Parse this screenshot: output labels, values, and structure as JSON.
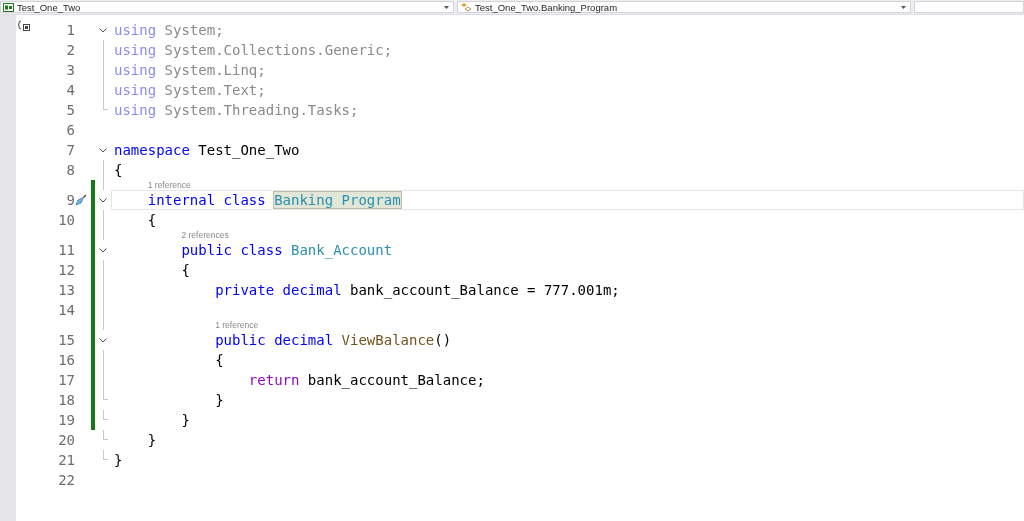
{
  "navigation_bar": {
    "project": "Test_One_Two",
    "type": "Test_One_Two.Banking_Program"
  },
  "editor": {
    "lines": [
      {
        "number": "1",
        "kind": "fold_start",
        "changed": false,
        "current": false,
        "quick_action": false,
        "tokens": [
          {
            "kind": "faded_keyword",
            "text": "using"
          },
          {
            "kind": "faded",
            "text": " System;"
          }
        ]
      },
      {
        "number": "2",
        "kind": "fold_inner",
        "changed": false,
        "current": false,
        "quick_action": false,
        "tokens": [
          {
            "kind": "faded_keyword",
            "text": "using"
          },
          {
            "kind": "faded",
            "text": " System.Collections.Generic;"
          }
        ]
      },
      {
        "number": "3",
        "kind": "fold_inner",
        "changed": false,
        "current": false,
        "quick_action": false,
        "tokens": [
          {
            "kind": "faded_keyword",
            "text": "using"
          },
          {
            "kind": "faded",
            "text": " System.Linq;"
          }
        ]
      },
      {
        "number": "4",
        "kind": "fold_inner",
        "changed": false,
        "current": false,
        "quick_action": false,
        "tokens": [
          {
            "kind": "faded_keyword",
            "text": "using"
          },
          {
            "kind": "faded",
            "text": " System.Text;"
          }
        ]
      },
      {
        "number": "5",
        "kind": "fold_end",
        "changed": false,
        "current": false,
        "quick_action": false,
        "tokens": [
          {
            "kind": "faded_keyword",
            "text": "using"
          },
          {
            "kind": "faded",
            "text": " System.Threading.Tasks;"
          }
        ]
      },
      {
        "number": "6",
        "kind": "plain",
        "changed": false,
        "current": false,
        "quick_action": false
      },
      {
        "number": "7",
        "kind": "fold_start",
        "changed": false,
        "current": false,
        "quick_action": false,
        "tokens": [
          {
            "kind": "keyword",
            "text": "namespace"
          },
          {
            "kind": "plain",
            "text": " Test_One_Two"
          }
        ]
      },
      {
        "number": "8",
        "kind": "fold_inner",
        "changed": false,
        "current": false,
        "quick_action": false,
        "tokens": [
          {
            "kind": "plain",
            "text": "{"
          }
        ]
      },
      {
        "number": "9",
        "kind": "fold_start",
        "changed": true,
        "current": true,
        "quick_action": true,
        "codelens": "1 reference",
        "tokens": [
          {
            "kind": "keyword",
            "text": "    internal class "
          },
          {
            "kind": "type",
            "text": "Banking_Program",
            "highlighted": true
          }
        ]
      },
      {
        "number": "10",
        "kind": "fold_inner",
        "changed": true,
        "current": false,
        "quick_action": false,
        "tokens": [
          {
            "kind": "plain",
            "text": "    {"
          }
        ]
      },
      {
        "number": "11",
        "kind": "fold_start",
        "changed": true,
        "current": false,
        "quick_action": false,
        "codelens": "2 references",
        "tokens": [
          {
            "kind": "keyword",
            "text": "        public class "
          },
          {
            "kind": "type",
            "text": "Bank_Account"
          }
        ]
      },
      {
        "number": "12",
        "kind": "fold_inner",
        "changed": true,
        "current": false,
        "quick_action": false,
        "tokens": [
          {
            "kind": "plain",
            "text": "        {"
          }
        ]
      },
      {
        "number": "13",
        "kind": "fold_inner",
        "changed": true,
        "current": false,
        "quick_action": false,
        "tokens": [
          {
            "kind": "keyword",
            "text": "            private decimal "
          },
          {
            "kind": "plain",
            "text": "bank_account_Balance = 777.001m;"
          }
        ]
      },
      {
        "number": "14",
        "kind": "fold_inner",
        "changed": true,
        "current": false,
        "quick_action": false
      },
      {
        "number": "15",
        "kind": "fold_start",
        "changed": true,
        "current": false,
        "quick_action": false,
        "codelens": "1 reference",
        "tokens": [
          {
            "kind": "keyword",
            "text": "            public decimal "
          },
          {
            "kind": "method",
            "text": "ViewBalance"
          },
          {
            "kind": "plain",
            "text": "()"
          }
        ]
      },
      {
        "number": "16",
        "kind": "fold_inner",
        "changed": true,
        "current": false,
        "quick_action": false,
        "tokens": [
          {
            "kind": "plain",
            "text": "            {"
          }
        ]
      },
      {
        "number": "17",
        "kind": "fold_inner",
        "changed": true,
        "current": false,
        "quick_action": false,
        "tokens": [
          {
            "kind": "control",
            "text": "                return"
          },
          {
            "kind": "plain",
            "text": " bank_account_Balance;"
          }
        ]
      },
      {
        "number": "18",
        "kind": "fold_end",
        "changed": true,
        "current": false,
        "quick_action": false,
        "tokens": [
          {
            "kind": "plain",
            "text": "            }"
          }
        ]
      },
      {
        "number": "19",
        "kind": "fold_end",
        "changed": true,
        "current": false,
        "quick_action": false,
        "tokens": [
          {
            "kind": "plain",
            "text": "        }"
          }
        ]
      },
      {
        "number": "20",
        "kind": "fold_end",
        "changed": false,
        "current": false,
        "quick_action": false,
        "tokens": [
          {
            "kind": "plain",
            "text": "    }"
          }
        ]
      },
      {
        "number": "21",
        "kind": "fold_end",
        "changed": false,
        "current": false,
        "quick_action": false,
        "tokens": [
          {
            "kind": "plain",
            "text": "}"
          }
        ]
      },
      {
        "number": "22",
        "kind": "plain",
        "changed": false,
        "current": false,
        "quick_action": false
      }
    ]
  }
}
